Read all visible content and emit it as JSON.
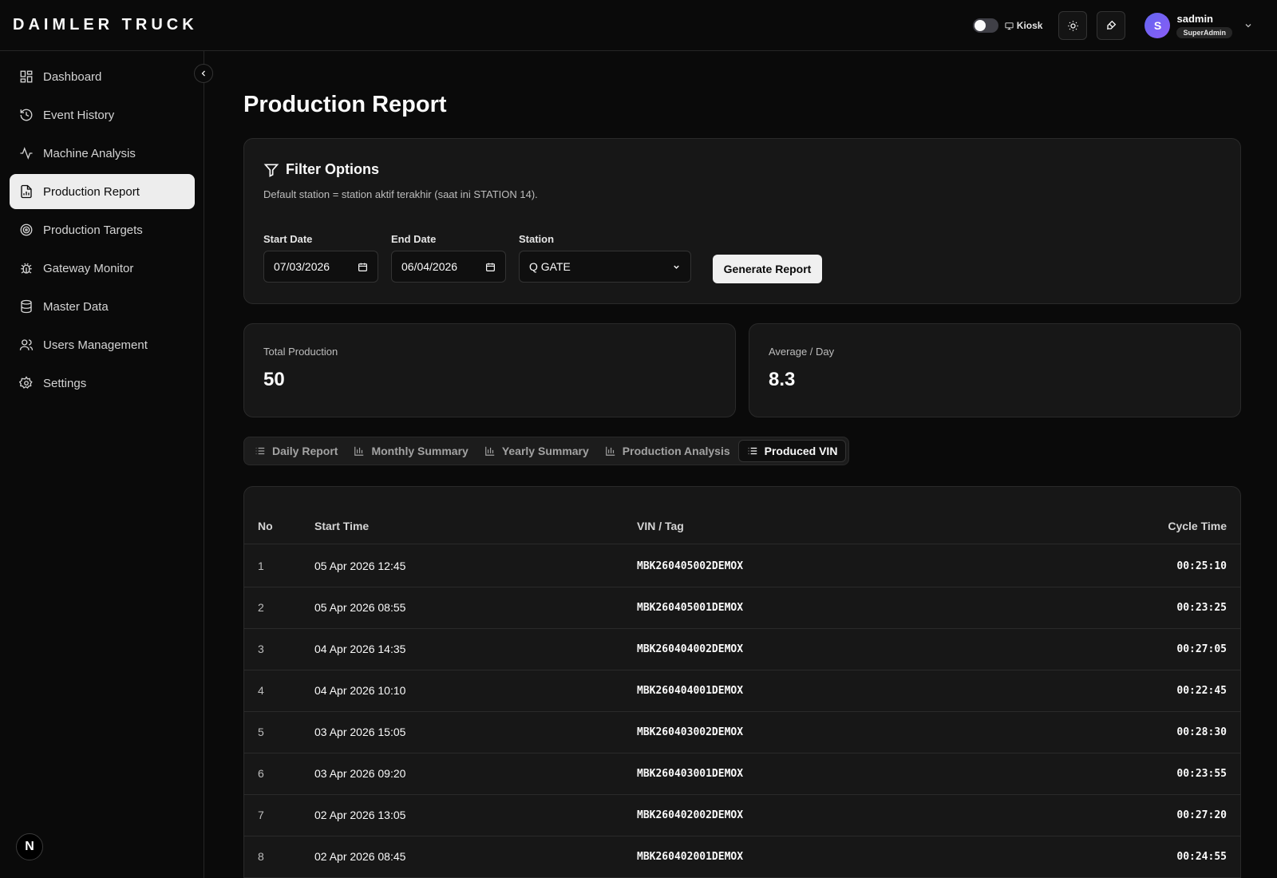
{
  "brand": "DAIMLER TRUCK",
  "header": {
    "kiosk_label": "Kiosk",
    "user": {
      "initial": "S",
      "name": "sadmin",
      "role": "SuperAdmin"
    }
  },
  "sidebar": {
    "items": [
      {
        "label": "Dashboard",
        "icon": "dashboard-icon"
      },
      {
        "label": "Event History",
        "icon": "history-icon"
      },
      {
        "label": "Machine Analysis",
        "icon": "activity-icon"
      },
      {
        "label": "Production Report",
        "icon": "report-icon",
        "active": true
      },
      {
        "label": "Production Targets",
        "icon": "target-icon"
      },
      {
        "label": "Gateway Monitor",
        "icon": "bug-icon"
      },
      {
        "label": "Master Data",
        "icon": "database-icon"
      },
      {
        "label": "Users Management",
        "icon": "users-icon"
      },
      {
        "label": "Settings",
        "icon": "gear-icon"
      }
    ],
    "footer_logo": "N"
  },
  "page": {
    "title": "Production Report",
    "filter": {
      "title": "Filter Options",
      "description": "Default station = station aktif terakhir (saat ini STATION 14).",
      "start_date_label": "Start Date",
      "start_date_value": "07/03/2026",
      "end_date_label": "End Date",
      "end_date_value": "06/04/2026",
      "station_label": "Station",
      "station_value": "Q GATE",
      "generate_label": "Generate Report"
    },
    "stats": {
      "total_label": "Total Production",
      "total_value": "50",
      "avg_label": "Average / Day",
      "avg_value": "8.3"
    },
    "tabs": [
      {
        "label": "Daily Report",
        "icon": "list-icon"
      },
      {
        "label": "Monthly Summary",
        "icon": "bar-chart-icon"
      },
      {
        "label": "Yearly Summary",
        "icon": "bar-chart-icon"
      },
      {
        "label": "Production Analysis",
        "icon": "bar-chart-icon"
      },
      {
        "label": "Produced VIN",
        "icon": "list-icon",
        "active": true
      }
    ],
    "table": {
      "headers": {
        "no": "No",
        "start": "Start Time",
        "vin": "VIN / Tag",
        "cycle": "Cycle Time"
      },
      "rows": [
        {
          "no": "1",
          "start": "05 Apr 2026 12:45",
          "vin": "MBK260405002DEMOX",
          "cycle": "00:25:10"
        },
        {
          "no": "2",
          "start": "05 Apr 2026 08:55",
          "vin": "MBK260405001DEMOX",
          "cycle": "00:23:25"
        },
        {
          "no": "3",
          "start": "04 Apr 2026 14:35",
          "vin": "MBK260404002DEMOX",
          "cycle": "00:27:05"
        },
        {
          "no": "4",
          "start": "04 Apr 2026 10:10",
          "vin": "MBK260404001DEMOX",
          "cycle": "00:22:45"
        },
        {
          "no": "5",
          "start": "03 Apr 2026 15:05",
          "vin": "MBK260403002DEMOX",
          "cycle": "00:28:30"
        },
        {
          "no": "6",
          "start": "03 Apr 2026 09:20",
          "vin": "MBK260403001DEMOX",
          "cycle": "00:23:55"
        },
        {
          "no": "7",
          "start": "02 Apr 2026 13:05",
          "vin": "MBK260402002DEMOX",
          "cycle": "00:27:20"
        },
        {
          "no": "8",
          "start": "02 Apr 2026 08:45",
          "vin": "MBK260402001DEMOX",
          "cycle": "00:24:55"
        }
      ]
    }
  }
}
